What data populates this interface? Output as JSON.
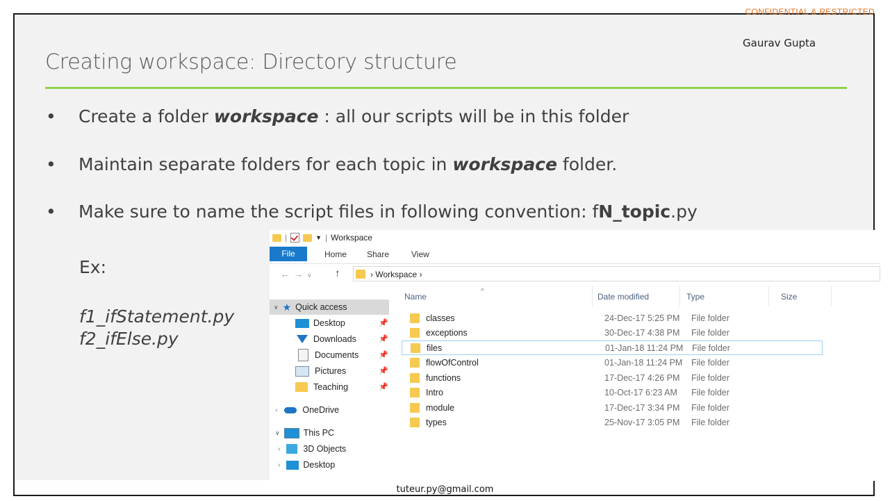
{
  "slide": {
    "confidential": "CONFIDENTIAL & RESTRICTED",
    "author": "Gaurav Gupta",
    "title": "Creating workspace: Directory structure",
    "bullets": [
      {
        "pre": "Create a folder ",
        "kw": "workspace",
        "post": " : all our scripts will be in this folder"
      },
      {
        "pre": "Maintain separate folders for each topic in ",
        "kw": "workspace",
        "post": " folder."
      },
      {
        "pre": "Make sure to name the script files in following convention: f",
        "kw": "N_topic",
        "post": ".py"
      }
    ],
    "example_label": "Ex:",
    "examples": [
      "f1_ifStatement.py",
      "f2_ifElse.py"
    ],
    "email": "tuteur.py@gmail.com"
  },
  "explorer": {
    "window_title": "Workspace",
    "ribbon_tabs": [
      "File",
      "Home",
      "Share",
      "View"
    ],
    "address": "Workspace",
    "columns": [
      "Name",
      "Date modified",
      "Type",
      "Size"
    ],
    "nav": [
      {
        "label": "Quick access",
        "icon": "star-icon"
      },
      {
        "label": "Desktop",
        "icon": "desktop-icon"
      },
      {
        "label": "Downloads",
        "icon": "download-icon"
      },
      {
        "label": "Documents",
        "icon": "documents-icon"
      },
      {
        "label": "Pictures",
        "icon": "pictures-icon"
      },
      {
        "label": "Teaching",
        "icon": "folder-icon"
      },
      {
        "label": "OneDrive",
        "icon": "cloud-icon"
      },
      {
        "label": "This PC",
        "icon": "pc-icon"
      },
      {
        "label": "3D Objects",
        "icon": "3d-objects-icon"
      },
      {
        "label": "Desktop",
        "icon": "desktop-icon"
      }
    ],
    "rows": [
      {
        "name": "classes",
        "date": "24-Dec-17 5:25 PM",
        "type": "File folder"
      },
      {
        "name": "exceptions",
        "date": "30-Dec-17 4:38 PM",
        "type": "File folder"
      },
      {
        "name": "files",
        "date": "01-Jan-18 11:24 PM",
        "type": "File folder"
      },
      {
        "name": "flowOfControl",
        "date": "01-Jan-18 11:24 PM",
        "type": "File folder"
      },
      {
        "name": "functions",
        "date": "17-Dec-17 4:26 PM",
        "type": "File folder"
      },
      {
        "name": "Intro",
        "date": "10-Oct-17 6:23 AM",
        "type": "File folder"
      },
      {
        "name": "module",
        "date": "17-Dec-17 3:34 PM",
        "type": "File folder"
      },
      {
        "name": "types",
        "date": "25-Nov-17 3:05 PM",
        "type": "File folder"
      }
    ],
    "selected_row": 2,
    "colors": {
      "accent_rule": "#8fd14f",
      "file_tab": "#1979ca",
      "confidential": "#e0701e"
    }
  }
}
